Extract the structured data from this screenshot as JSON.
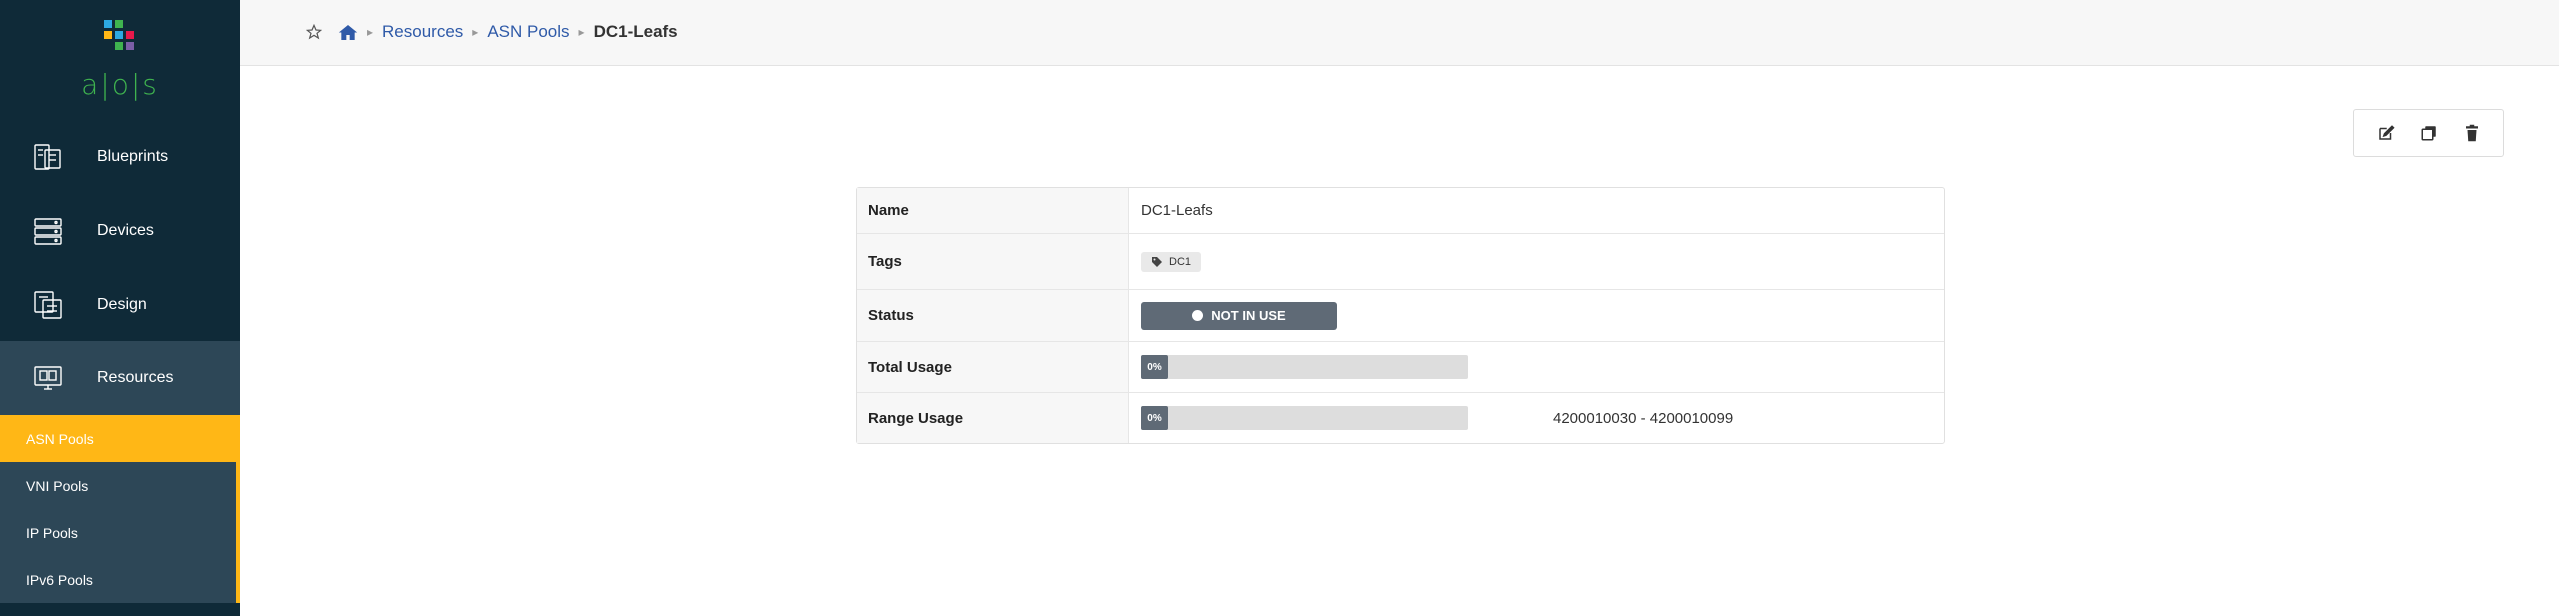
{
  "app": {
    "logo_text": "a|o|s",
    "logo_colors": [
      "#2da9e1",
      "#3fb34f",
      "#ffb716",
      "#e6194b"
    ]
  },
  "sidebar": {
    "items": [
      {
        "label": "Blueprints",
        "icon": "blueprints-icon"
      },
      {
        "label": "Devices",
        "icon": "devices-icon"
      },
      {
        "label": "Design",
        "icon": "design-icon"
      },
      {
        "label": "Resources",
        "icon": "resources-icon",
        "active": true
      }
    ],
    "sub_items": [
      {
        "label": "ASN Pools",
        "active": true
      },
      {
        "label": "VNI Pools"
      },
      {
        "label": "IP Pools"
      },
      {
        "label": "IPv6 Pools"
      }
    ]
  },
  "breadcrumb": {
    "items": [
      "Resources",
      "ASN Pools"
    ],
    "current": "DC1-Leafs"
  },
  "actions": [
    "edit-icon",
    "clone-icon",
    "delete-icon"
  ],
  "details": {
    "rows": [
      {
        "key": "Name",
        "value": "DC1-Leafs"
      },
      {
        "key": "Tags",
        "tag": "DC1"
      },
      {
        "key": "Status",
        "status": "NOT IN USE"
      },
      {
        "key": "Total Usage",
        "progress_label": "0%",
        "progress_fraction": 0
      },
      {
        "key": "Range Usage",
        "progress_label": "0%",
        "progress_fraction": 0,
        "range": "4200010030 - 4200010099"
      }
    ]
  },
  "colors": {
    "sidebar_bg": "#0f2a38",
    "accent": "#ffb716",
    "link": "#2f5aa8",
    "status_bg": "#5f6a76"
  }
}
